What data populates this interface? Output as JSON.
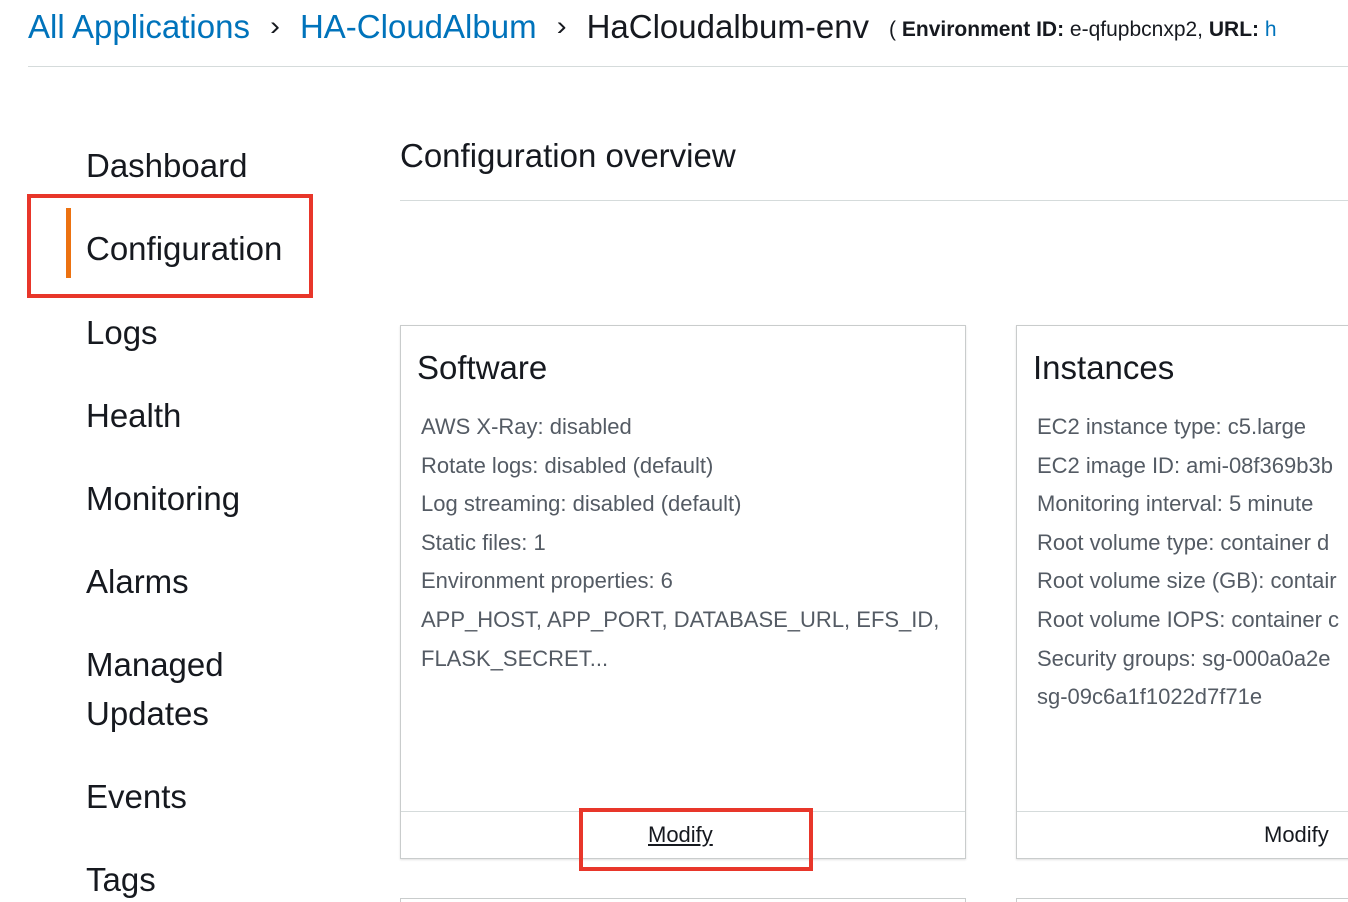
{
  "breadcrumb": {
    "items": [
      "All Applications",
      "HA-CloudAlbum"
    ],
    "separator": "›",
    "current": "HaCloudalbum-env",
    "env_open": "(",
    "env_id_label": "Environment ID:",
    "env_id_value": "e-qfupbcnxp2,",
    "url_label": "URL:",
    "url_value": "h"
  },
  "sidebar": {
    "items": [
      {
        "label": "Dashboard",
        "active": false
      },
      {
        "label": "Configuration",
        "active": true
      },
      {
        "label": "Logs",
        "active": false
      },
      {
        "label": "Health",
        "active": false
      },
      {
        "label": "Monitoring",
        "active": false
      },
      {
        "label": "Alarms",
        "active": false
      },
      {
        "label": "Managed",
        "active": false
      },
      {
        "label": "Updates",
        "active": false
      },
      {
        "label": "Events",
        "active": false
      },
      {
        "label": "Tags",
        "active": false
      }
    ]
  },
  "main": {
    "title": "Configuration overview",
    "cards": [
      {
        "title": "Software",
        "lines": [
          "AWS X-Ray: disabled",
          "Rotate logs: disabled (default)",
          "Log streaming: disabled (default)",
          "Static files: 1",
          "Environment properties: 6",
          "APP_HOST, APP_PORT, DATABASE_URL, EFS_ID,",
          "FLASK_SECRET..."
        ],
        "action": "Modify"
      },
      {
        "title": "Instances",
        "lines": [
          "EC2 instance type: c5.large",
          "EC2 image ID: ami-08f369b3b",
          "Monitoring interval: 5 minute",
          "Root volume type: container d",
          "Root volume size (GB): contair",
          "Root volume IOPS: container c",
          "Security groups: sg-000a0a2e",
          "sg-09c6a1f1022d7f71e"
        ],
        "action": "Modify"
      }
    ]
  },
  "colors": {
    "link": "#0073bb",
    "active_indicator": "#ec7211",
    "highlight": "#e8362a",
    "body_text": "#545b64"
  }
}
